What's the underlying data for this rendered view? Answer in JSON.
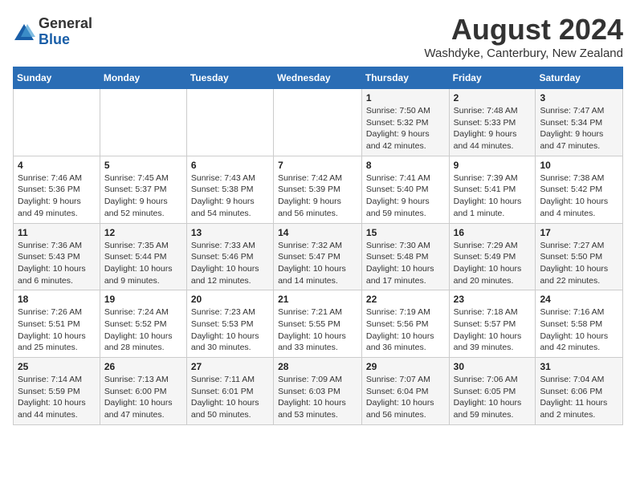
{
  "header": {
    "logo_general": "General",
    "logo_blue": "Blue",
    "main_title": "August 2024",
    "subtitle": "Washdyke, Canterbury, New Zealand"
  },
  "calendar": {
    "days_of_week": [
      "Sunday",
      "Monday",
      "Tuesday",
      "Wednesday",
      "Thursday",
      "Friday",
      "Saturday"
    ],
    "weeks": [
      {
        "row_class": "row-1",
        "days": [
          {
            "num": "",
            "detail": ""
          },
          {
            "num": "",
            "detail": ""
          },
          {
            "num": "",
            "detail": ""
          },
          {
            "num": "",
            "detail": ""
          },
          {
            "num": "1",
            "detail": "Sunrise: 7:50 AM\nSunset: 5:32 PM\nDaylight: 9 hours\nand 42 minutes."
          },
          {
            "num": "2",
            "detail": "Sunrise: 7:48 AM\nSunset: 5:33 PM\nDaylight: 9 hours\nand 44 minutes."
          },
          {
            "num": "3",
            "detail": "Sunrise: 7:47 AM\nSunset: 5:34 PM\nDaylight: 9 hours\nand 47 minutes."
          }
        ]
      },
      {
        "row_class": "row-2",
        "days": [
          {
            "num": "4",
            "detail": "Sunrise: 7:46 AM\nSunset: 5:36 PM\nDaylight: 9 hours\nand 49 minutes."
          },
          {
            "num": "5",
            "detail": "Sunrise: 7:45 AM\nSunset: 5:37 PM\nDaylight: 9 hours\nand 52 minutes."
          },
          {
            "num": "6",
            "detail": "Sunrise: 7:43 AM\nSunset: 5:38 PM\nDaylight: 9 hours\nand 54 minutes."
          },
          {
            "num": "7",
            "detail": "Sunrise: 7:42 AM\nSunset: 5:39 PM\nDaylight: 9 hours\nand 56 minutes."
          },
          {
            "num": "8",
            "detail": "Sunrise: 7:41 AM\nSunset: 5:40 PM\nDaylight: 9 hours\nand 59 minutes."
          },
          {
            "num": "9",
            "detail": "Sunrise: 7:39 AM\nSunset: 5:41 PM\nDaylight: 10 hours\nand 1 minute."
          },
          {
            "num": "10",
            "detail": "Sunrise: 7:38 AM\nSunset: 5:42 PM\nDaylight: 10 hours\nand 4 minutes."
          }
        ]
      },
      {
        "row_class": "row-3",
        "days": [
          {
            "num": "11",
            "detail": "Sunrise: 7:36 AM\nSunset: 5:43 PM\nDaylight: 10 hours\nand 6 minutes."
          },
          {
            "num": "12",
            "detail": "Sunrise: 7:35 AM\nSunset: 5:44 PM\nDaylight: 10 hours\nand 9 minutes."
          },
          {
            "num": "13",
            "detail": "Sunrise: 7:33 AM\nSunset: 5:46 PM\nDaylight: 10 hours\nand 12 minutes."
          },
          {
            "num": "14",
            "detail": "Sunrise: 7:32 AM\nSunset: 5:47 PM\nDaylight: 10 hours\nand 14 minutes."
          },
          {
            "num": "15",
            "detail": "Sunrise: 7:30 AM\nSunset: 5:48 PM\nDaylight: 10 hours\nand 17 minutes."
          },
          {
            "num": "16",
            "detail": "Sunrise: 7:29 AM\nSunset: 5:49 PM\nDaylight: 10 hours\nand 20 minutes."
          },
          {
            "num": "17",
            "detail": "Sunrise: 7:27 AM\nSunset: 5:50 PM\nDaylight: 10 hours\nand 22 minutes."
          }
        ]
      },
      {
        "row_class": "row-4",
        "days": [
          {
            "num": "18",
            "detail": "Sunrise: 7:26 AM\nSunset: 5:51 PM\nDaylight: 10 hours\nand 25 minutes."
          },
          {
            "num": "19",
            "detail": "Sunrise: 7:24 AM\nSunset: 5:52 PM\nDaylight: 10 hours\nand 28 minutes."
          },
          {
            "num": "20",
            "detail": "Sunrise: 7:23 AM\nSunset: 5:53 PM\nDaylight: 10 hours\nand 30 minutes."
          },
          {
            "num": "21",
            "detail": "Sunrise: 7:21 AM\nSunset: 5:55 PM\nDaylight: 10 hours\nand 33 minutes."
          },
          {
            "num": "22",
            "detail": "Sunrise: 7:19 AM\nSunset: 5:56 PM\nDaylight: 10 hours\nand 36 minutes."
          },
          {
            "num": "23",
            "detail": "Sunrise: 7:18 AM\nSunset: 5:57 PM\nDaylight: 10 hours\nand 39 minutes."
          },
          {
            "num": "24",
            "detail": "Sunrise: 7:16 AM\nSunset: 5:58 PM\nDaylight: 10 hours\nand 42 minutes."
          }
        ]
      },
      {
        "row_class": "row-5",
        "days": [
          {
            "num": "25",
            "detail": "Sunrise: 7:14 AM\nSunset: 5:59 PM\nDaylight: 10 hours\nand 44 minutes."
          },
          {
            "num": "26",
            "detail": "Sunrise: 7:13 AM\nSunset: 6:00 PM\nDaylight: 10 hours\nand 47 minutes."
          },
          {
            "num": "27",
            "detail": "Sunrise: 7:11 AM\nSunset: 6:01 PM\nDaylight: 10 hours\nand 50 minutes."
          },
          {
            "num": "28",
            "detail": "Sunrise: 7:09 AM\nSunset: 6:03 PM\nDaylight: 10 hours\nand 53 minutes."
          },
          {
            "num": "29",
            "detail": "Sunrise: 7:07 AM\nSunset: 6:04 PM\nDaylight: 10 hours\nand 56 minutes."
          },
          {
            "num": "30",
            "detail": "Sunrise: 7:06 AM\nSunset: 6:05 PM\nDaylight: 10 hours\nand 59 minutes."
          },
          {
            "num": "31",
            "detail": "Sunrise: 7:04 AM\nSunset: 6:06 PM\nDaylight: 11 hours\nand 2 minutes."
          }
        ]
      }
    ]
  }
}
